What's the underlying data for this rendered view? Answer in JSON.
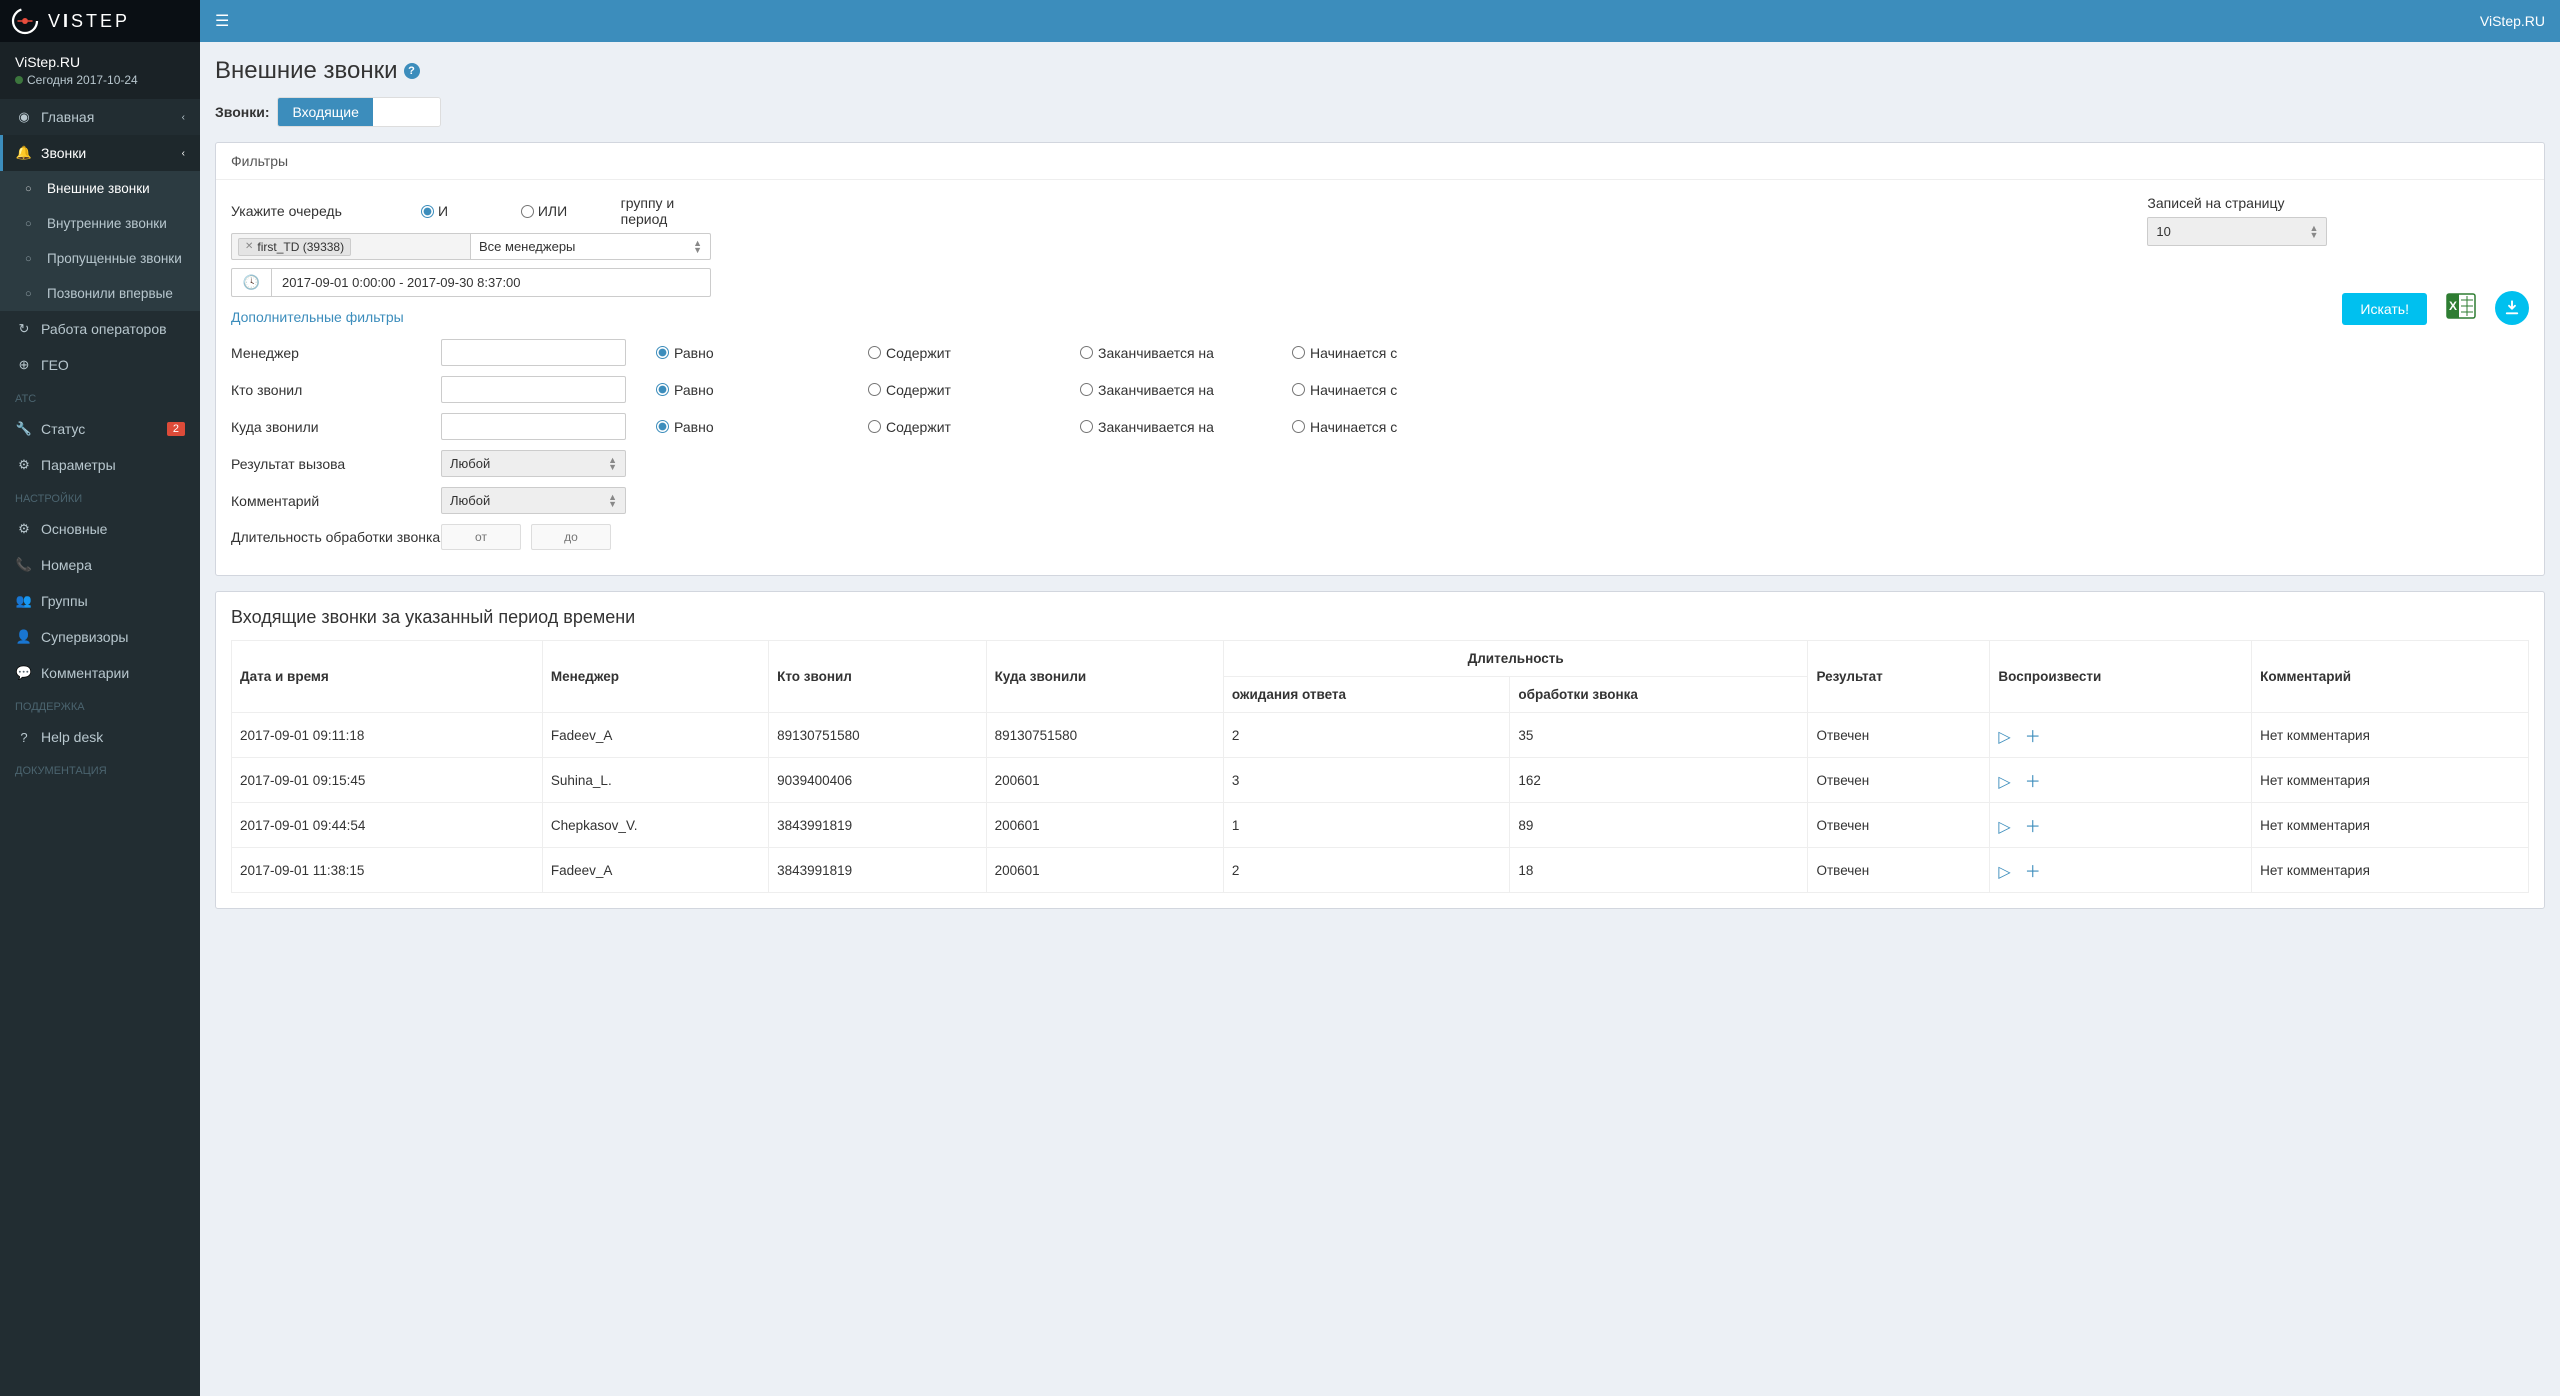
{
  "brand": {
    "name_part1": "V",
    "name_part2": "I",
    "name_part3": "STEP"
  },
  "topbar": {
    "right": "ViStep.RU"
  },
  "user": {
    "name": "ViStep.RU",
    "status_prefix": "Сегодня",
    "status_date": "2017-10-24"
  },
  "sidebar": {
    "main": [
      {
        "icon": "dashboard",
        "label": "Главная",
        "chev": true
      },
      {
        "icon": "bell",
        "label": "Звонки",
        "chev": true,
        "active": true
      }
    ],
    "sub": [
      {
        "label": "Внешние звонки",
        "active": true
      },
      {
        "label": "Внутренние звонки"
      },
      {
        "label": "Пропущенные звонки"
      },
      {
        "label": "Позвонили впервые"
      }
    ],
    "after": [
      {
        "icon": "refresh",
        "label": "Работа операторов"
      },
      {
        "icon": "globe",
        "label": "ГЕО"
      }
    ],
    "sec_atc": "АТС",
    "atc": [
      {
        "icon": "wrench",
        "label": "Статус",
        "badge": "2"
      },
      {
        "icon": "sliders",
        "label": "Параметры"
      }
    ],
    "sec_settings": "НАСТРОЙКИ",
    "settings": [
      {
        "icon": "gear",
        "label": "Основные"
      },
      {
        "icon": "phone",
        "label": "Номера"
      },
      {
        "icon": "users",
        "label": "Группы"
      },
      {
        "icon": "person",
        "label": "Супервизоры"
      },
      {
        "icon": "comment",
        "label": "Комментарии"
      }
    ],
    "sec_support": "ПОДДЕРЖКА",
    "support": [
      {
        "icon": "question",
        "label": "Help desk"
      }
    ],
    "sec_docs": "ДОКУМЕНТАЦИЯ"
  },
  "page": {
    "title": "Внешние звонки",
    "calls_label": "Звонки:",
    "tab_incoming": "Входящие"
  },
  "filters": {
    "header": "Фильтры",
    "queue_label": "Укажите очередь",
    "and": "И",
    "or": "ИЛИ",
    "group_period": "группу и период",
    "queue_tag": "first_TD (39338)",
    "managers_select": "Все менеджеры",
    "date_range": "2017-09-01 0:00:00 - 2017-09-30 8:37:00",
    "records_label": "Записей на страницу",
    "records_value": "10",
    "search_btn": "Искать!",
    "extra_link": "Дополнительные фильтры",
    "adv": {
      "manager": "Менеджер",
      "caller": "Кто звонил",
      "callee": "Куда звонили",
      "result": "Результат вызова",
      "comment": "Комментарий",
      "duration": "Длительность обработки звонка",
      "any": "Любой",
      "from": "от",
      "to": "до",
      "eq": "Равно",
      "contains": "Содержит",
      "ends": "Заканчивается на",
      "starts": "Начинается с"
    }
  },
  "table": {
    "title": "Входящие звонки за указанный период времени",
    "headers": {
      "datetime": "Дата и время",
      "manager": "Менеджер",
      "caller": "Кто звонил",
      "callee": "Куда звонили",
      "duration_group": "Длительность",
      "wait": "ожидания ответа",
      "handle": "обработки звонка",
      "result": "Результат",
      "play": "Воспроизвести",
      "comment": "Комментарий"
    },
    "rows": [
      {
        "dt": "2017-09-01 09:11:18",
        "mgr": "Fadeev_A",
        "from": "89130751580",
        "to": "89130751580",
        "wait": "2",
        "handle": "35",
        "res": "Отвечен",
        "comment": "Нет комментария"
      },
      {
        "dt": "2017-09-01 09:15:45",
        "mgr": "Suhina_L.",
        "from": "9039400406",
        "to": "200601",
        "wait": "3",
        "handle": "162",
        "res": "Отвечен",
        "comment": "Нет комментария"
      },
      {
        "dt": "2017-09-01 09:44:54",
        "mgr": "Chepkasov_V.",
        "from": "3843991819",
        "to": "200601",
        "wait": "1",
        "handle": "89",
        "res": "Отвечен",
        "comment": "Нет комментария"
      },
      {
        "dt": "2017-09-01 11:38:15",
        "mgr": "Fadeev_A",
        "from": "3843991819",
        "to": "200601",
        "wait": "2",
        "handle": "18",
        "res": "Отвечен",
        "comment": "Нет комментария"
      }
    ]
  }
}
